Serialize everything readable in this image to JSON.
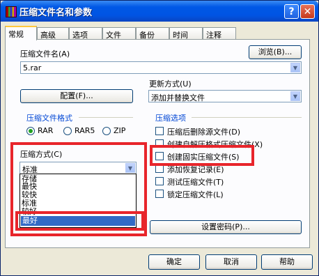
{
  "window": {
    "title": "压缩文件名和参数"
  },
  "tabs": [
    "常规",
    "高级",
    "选项",
    "文件",
    "备份",
    "时间",
    "注释"
  ],
  "archive": {
    "label": "压缩文件名(A)",
    "value": "5.rar",
    "browse_button": "浏览(B)..."
  },
  "update": {
    "label": "更新方式(U)",
    "value": "添加并替换文件"
  },
  "profile_button": "配置(F)...",
  "format": {
    "group_title": "压缩文件格式",
    "options": [
      "RAR",
      "RAR5",
      "ZIP"
    ],
    "selected": "RAR"
  },
  "method": {
    "label": "压缩方式(C)",
    "value": "标准",
    "dropdown_items": [
      "存储",
      "最快",
      "较快",
      "标准",
      "较好"
    ],
    "highlighted": "最好"
  },
  "options": {
    "group_title": "压缩选项",
    "items": [
      "压缩后删除源文件(D)",
      "创建自解压格式压缩文件(X)",
      "创建固实压缩文件(S)",
      "添加恢复记录(E)",
      "测试压缩文件(T)",
      "锁定压缩文件(L)"
    ]
  },
  "password_button": "设置密码(P)...",
  "footer": {
    "ok": "确定",
    "cancel": "取消",
    "help": "帮助"
  }
}
